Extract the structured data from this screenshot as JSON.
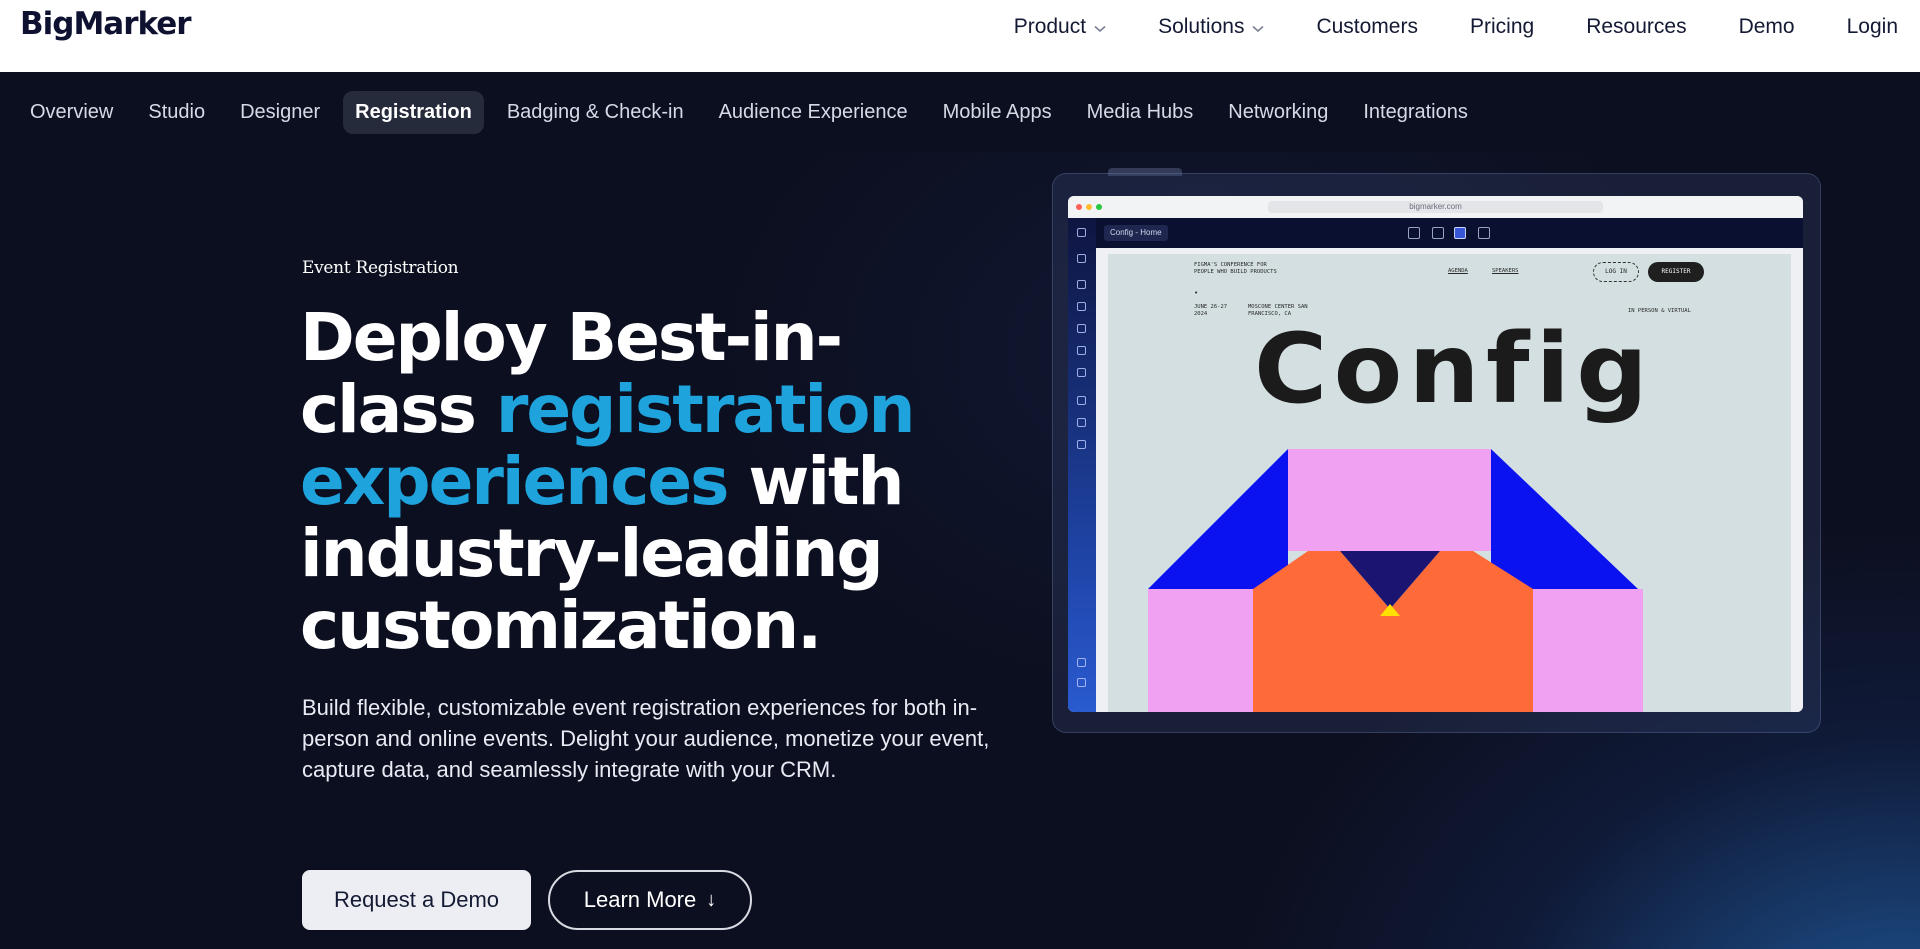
{
  "brand": {
    "name": "BigMarker"
  },
  "nav": {
    "items": [
      {
        "label": "Product",
        "has_dropdown": true
      },
      {
        "label": "Solutions",
        "has_dropdown": true
      },
      {
        "label": "Customers",
        "has_dropdown": false
      },
      {
        "label": "Pricing",
        "has_dropdown": false
      },
      {
        "label": "Resources",
        "has_dropdown": false
      },
      {
        "label": "Demo",
        "has_dropdown": false
      },
      {
        "label": "Login",
        "has_dropdown": false
      }
    ]
  },
  "subnav": {
    "active": "Registration",
    "items": [
      "Overview",
      "Studio",
      "Designer",
      "Registration",
      "Badging & Check-in",
      "Audience Experience",
      "Mobile Apps",
      "Media Hubs",
      "Networking",
      "Integrations"
    ]
  },
  "hero": {
    "eyebrow": "Event Registration",
    "headline_1": "Deploy Best-in-class ",
    "headline_accent": "registration experiences",
    "headline_2": " with industry-leading customization.",
    "description": "Build flexible, customizable event registration experiences for both in-person and online events. Delight your audience, monetize your event, capture data, and seamlessly integrate with your CRM.",
    "cta_primary": "Request a Demo",
    "cta_secondary": "Learn More"
  },
  "mockup": {
    "url": "bigmarker.com",
    "page_selector": "Config - Home",
    "site": {
      "tagline": "FIGMA'S CONFERENCE FOR PEOPLE WHO BUILD PRODUCTS",
      "nav_agenda": "AGENDA",
      "nav_speakers": "SPEAKERS",
      "login": "LOG IN",
      "register": "REGISTER",
      "date": "JUNE 26-27 2024",
      "venue": "MOSCONE CENTER SAN FRANCISCO, CA",
      "format": "IN PERSON & VIRTUAL",
      "wordmark": "Config"
    }
  },
  "colors": {
    "accent": "#1fa3dd",
    "background": "#0c0f1f",
    "active_subnav": "#262b3b"
  }
}
